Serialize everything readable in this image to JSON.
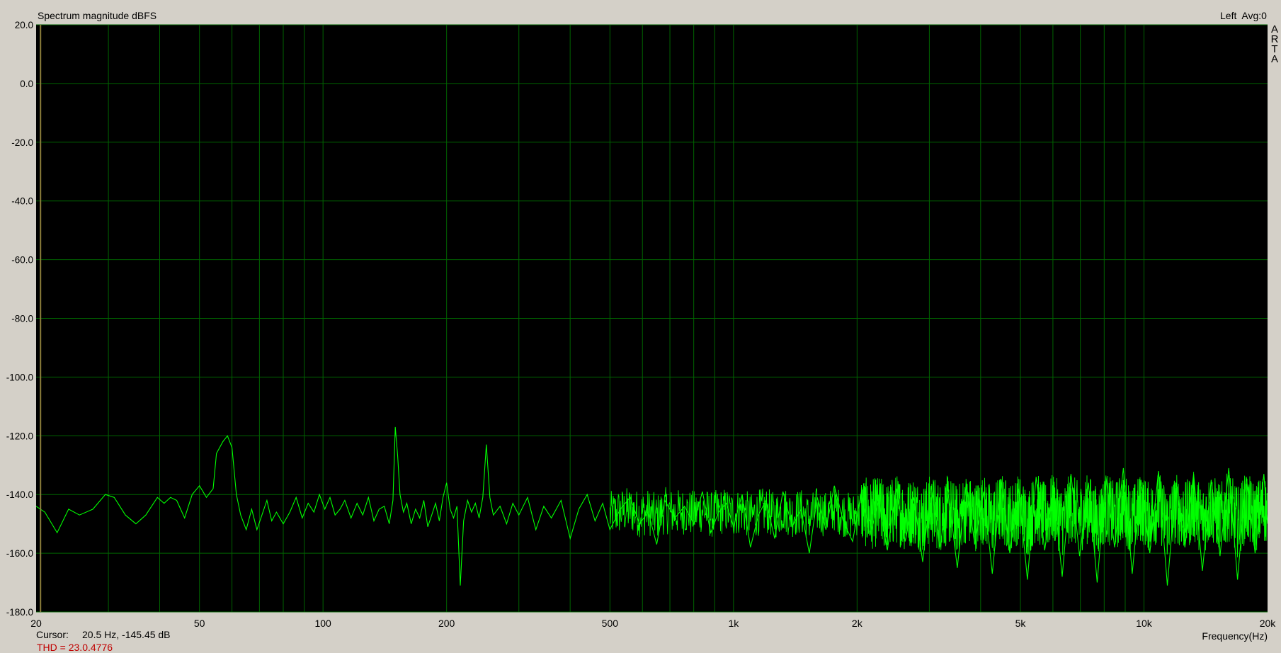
{
  "window": {
    "plot_title": "Spectrum magnitude dBFS",
    "channel_info": "Left  Avg:0",
    "brand_letters": [
      "A",
      "R",
      "T",
      "A"
    ],
    "cursor_label": "Cursor:",
    "cursor_value": "20.5 Hz, -145.45 dB",
    "thd_partial": "THD = 23.0.4776"
  },
  "colors": {
    "background": "#d4d0c8",
    "plot_background": "#000000",
    "grid": "#006400",
    "trace": "#00ff00",
    "cursor_line": "#8b7d3a"
  },
  "chart_data": {
    "type": "line",
    "title": "Spectrum magnitude dBFS",
    "xlabel": "Frequency(Hz)",
    "ylabel": "",
    "xscale": "log",
    "xlim": [
      20,
      20000
    ],
    "ylim": [
      -180,
      20
    ],
    "grid": true,
    "x_ticks": [
      {
        "value": 20,
        "label": "20"
      },
      {
        "value": 50,
        "label": "50"
      },
      {
        "value": 100,
        "label": "100"
      },
      {
        "value": 200,
        "label": "200"
      },
      {
        "value": 500,
        "label": "500"
      },
      {
        "value": 1000,
        "label": "1k"
      },
      {
        "value": 2000,
        "label": "2k"
      },
      {
        "value": 5000,
        "label": "5k"
      },
      {
        "value": 10000,
        "label": "10k"
      },
      {
        "value": 20000,
        "label": "20k"
      }
    ],
    "y_ticks": [
      20,
      0,
      -20,
      -40,
      -60,
      -80,
      -100,
      -120,
      -140,
      -160,
      -180
    ],
    "y_tick_labels": [
      "20.0",
      "0.0",
      "-20.0",
      "-40.0",
      "-60.0",
      "-80.0",
      "-100.0",
      "-120.0",
      "-140.0",
      "-160.0",
      "-180.0"
    ],
    "cursor": {
      "x": 20.5,
      "y": -145.45
    },
    "series": [
      {
        "values": [
          [
            20,
            -144
          ],
          [
            21,
            -146
          ],
          [
            22.5,
            -153
          ],
          [
            24,
            -145
          ],
          [
            25.5,
            -147
          ],
          [
            27.5,
            -145
          ],
          [
            29.5,
            -140
          ],
          [
            31,
            -141
          ],
          [
            33,
            -147
          ],
          [
            35,
            -150
          ],
          [
            37,
            -147
          ],
          [
            39.5,
            -141
          ],
          [
            41,
            -143
          ],
          [
            42.5,
            -141
          ],
          [
            44,
            -142
          ],
          [
            46,
            -148
          ],
          [
            48,
            -140
          ],
          [
            50,
            -137
          ],
          [
            52,
            -141
          ],
          [
            54,
            -138
          ],
          [
            55,
            -126
          ],
          [
            57,
            -122
          ],
          [
            58.5,
            -120
          ],
          [
            60,
            -124
          ],
          [
            61.5,
            -140
          ],
          [
            63,
            -147
          ],
          [
            65,
            -152
          ],
          [
            67,
            -145
          ],
          [
            69,
            -152
          ],
          [
            71,
            -147
          ],
          [
            73,
            -142
          ],
          [
            75,
            -149
          ],
          [
            77,
            -146
          ],
          [
            80,
            -150
          ],
          [
            83,
            -146
          ],
          [
            86,
            -141
          ],
          [
            89,
            -148
          ],
          [
            92,
            -143
          ],
          [
            95,
            -146
          ],
          [
            98,
            -140
          ],
          [
            101,
            -145
          ],
          [
            104,
            -141
          ],
          [
            107,
            -147
          ],
          [
            110,
            -145
          ],
          [
            113,
            -142
          ],
          [
            117,
            -148
          ],
          [
            121,
            -143
          ],
          [
            125,
            -147
          ],
          [
            129,
            -141
          ],
          [
            133,
            -149
          ],
          [
            137,
            -145
          ],
          [
            141,
            -144
          ],
          [
            145,
            -150
          ],
          [
            148,
            -142
          ],
          [
            150,
            -117
          ],
          [
            152,
            -127
          ],
          [
            154,
            -140
          ],
          [
            157,
            -146
          ],
          [
            160,
            -143
          ],
          [
            164,
            -150
          ],
          [
            168,
            -145
          ],
          [
            172,
            -148
          ],
          [
            176,
            -142
          ],
          [
            180,
            -151
          ],
          [
            184,
            -147
          ],
          [
            188,
            -143
          ],
          [
            192,
            -149
          ],
          [
            196,
            -141
          ],
          [
            200,
            -136
          ],
          [
            204,
            -145
          ],
          [
            208,
            -148
          ],
          [
            212,
            -144
          ],
          [
            216,
            -171
          ],
          [
            220,
            -149
          ],
          [
            225,
            -142
          ],
          [
            230,
            -146
          ],
          [
            235,
            -143
          ],
          [
            240,
            -148
          ],
          [
            245,
            -141
          ],
          [
            250,
            -123
          ],
          [
            255,
            -141
          ],
          [
            260,
            -147
          ],
          [
            270,
            -144
          ],
          [
            280,
            -150
          ],
          [
            290,
            -143
          ],
          [
            300,
            -147
          ],
          [
            315,
            -141
          ],
          [
            330,
            -152
          ],
          [
            345,
            -144
          ],
          [
            360,
            -148
          ],
          [
            380,
            -142
          ],
          [
            400,
            -155
          ],
          [
            420,
            -145
          ],
          [
            440,
            -140
          ],
          [
            460,
            -149
          ],
          [
            480,
            -143
          ],
          [
            500,
            -152
          ],
          [
            530,
            -145
          ],
          [
            560,
            -141
          ],
          [
            590,
            -150
          ],
          [
            620,
            -146
          ],
          [
            650,
            -157
          ],
          [
            680,
            -142
          ],
          [
            720,
            -148
          ],
          [
            760,
            -144
          ],
          [
            800,
            -150
          ],
          [
            840,
            -139
          ],
          [
            880,
            -153
          ],
          [
            920,
            -146
          ],
          [
            960,
            -143
          ],
          [
            1000,
            -151
          ],
          [
            1050,
            -140
          ],
          [
            1100,
            -158
          ],
          [
            1150,
            -147
          ],
          [
            1200,
            -142
          ],
          [
            1260,
            -155
          ],
          [
            1320,
            -139
          ],
          [
            1390,
            -151
          ],
          [
            1460,
            -145
          ],
          [
            1530,
            -160
          ],
          [
            1600,
            -141
          ],
          [
            1680,
            -152
          ],
          [
            1760,
            -137
          ],
          [
            1850,
            -149
          ],
          [
            1950,
            -156
          ],
          [
            2050,
            -139
          ],
          [
            2150,
            -154
          ],
          [
            2260,
            -142
          ],
          [
            2370,
            -159
          ],
          [
            2490,
            -138
          ],
          [
            2620,
            -156
          ],
          [
            2750,
            -141
          ],
          [
            2890,
            -163
          ],
          [
            3030,
            -137
          ],
          [
            3180,
            -158
          ],
          [
            3340,
            -140
          ],
          [
            3510,
            -165
          ],
          [
            3690,
            -136
          ],
          [
            3870,
            -157
          ],
          [
            4070,
            -139
          ],
          [
            4270,
            -167
          ],
          [
            4490,
            -135
          ],
          [
            4710,
            -160
          ],
          [
            4950,
            -138
          ],
          [
            5200,
            -169
          ],
          [
            5460,
            -134
          ],
          [
            5730,
            -159
          ],
          [
            6020,
            -137
          ],
          [
            6320,
            -168
          ],
          [
            6640,
            -133
          ],
          [
            6970,
            -161
          ],
          [
            7320,
            -136
          ],
          [
            7690,
            -170
          ],
          [
            8080,
            -134
          ],
          [
            8480,
            -158
          ],
          [
            8910,
            -131
          ],
          [
            9360,
            -167
          ],
          [
            9830,
            -135
          ],
          [
            10330,
            -160
          ],
          [
            10850,
            -132
          ],
          [
            11400,
            -171
          ],
          [
            11970,
            -136
          ],
          [
            12580,
            -158
          ],
          [
            13210,
            -133
          ],
          [
            13880,
            -166
          ],
          [
            14580,
            -135
          ],
          [
            15320,
            -161
          ],
          [
            16090,
            -131
          ],
          [
            16900,
            -169
          ],
          [
            17750,
            -134
          ],
          [
            18650,
            -160
          ],
          [
            19590,
            -133
          ],
          [
            20000,
            -150
          ]
        ]
      }
    ]
  }
}
